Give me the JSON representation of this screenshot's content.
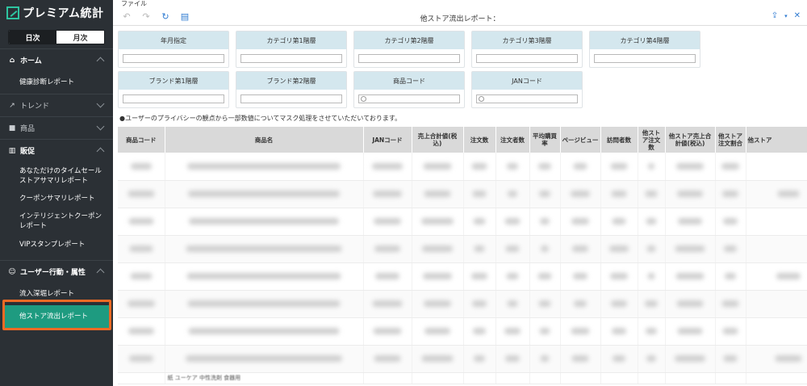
{
  "app": {
    "logo_text": "プレミアム統計",
    "period_toggle": {
      "daily": "日次",
      "monthly": "月次",
      "selected": "monthly"
    }
  },
  "sidebar": {
    "sections": [
      {
        "label": "ホーム",
        "icon": "home-icon",
        "expanded": true
      },
      {
        "label": "トレンド",
        "icon": "trend-icon",
        "expanded": false
      },
      {
        "label": "商品",
        "icon": "folder-icon",
        "expanded": false
      },
      {
        "label": "販促",
        "icon": "bar-chart-icon",
        "expanded": true
      },
      {
        "label": "ユーザー行動・属性",
        "icon": "user-icon",
        "expanded": true
      }
    ],
    "items": {
      "health": "健康診断レポート",
      "timesale": "あなただけのタイムセールストアサマリレポート",
      "coupon": "クーポンサマリレポート",
      "intelligent": "インテリジェントクーポンレポート",
      "vip": "VIPスタンプレポート",
      "inflow": "流入深堀レポート",
      "outflow": "他ストア流出レポート"
    },
    "selected_item": "他ストア流出レポート"
  },
  "main": {
    "menu_file": "ファイル",
    "report_title": "他ストア流出レポート：",
    "filters": [
      {
        "label": "年月指定",
        "placeholder": ""
      },
      {
        "label": "カテゴリ第1階層",
        "placeholder": ""
      },
      {
        "label": "カテゴリ第2階層",
        "placeholder": ""
      },
      {
        "label": "カテゴリ第3階層",
        "placeholder": ""
      },
      {
        "label": "カテゴリ第4階層",
        "placeholder": ""
      },
      {
        "label": "ブランド第1階層",
        "placeholder": ""
      },
      {
        "label": "ブランド第2階層",
        "placeholder": ""
      },
      {
        "label": "商品コード",
        "placeholder": ""
      },
      {
        "label": "JANコード",
        "placeholder": ""
      }
    ],
    "notice": "●ユーザーのプライバシーの観点から一部数値についてマスク処理をさせていただいております。",
    "table": {
      "headers": [
        "商品コード",
        "商品名",
        "JANコード",
        "売上合計値(税込)",
        "注文数",
        "注文者数",
        "平均購買率",
        "ページビュー",
        "訪問者数",
        "他ストア注文数",
        "他ストア売上合計値(税込)",
        "他ストア注文割合",
        "他ストア"
      ],
      "row_count": 8,
      "last_row_peek": "紙 ユーケア 中性洗剤 食器用"
    }
  },
  "colors": {
    "sidebar_bg": "#2b3035",
    "selected_bg": "#1e9b80",
    "highlight_border": "#ee6a24",
    "filter_header_bg": "#d4e7ee",
    "table_header_bg": "#d9d9d9",
    "toolbar_icon_blue": "#2f7bd1"
  }
}
